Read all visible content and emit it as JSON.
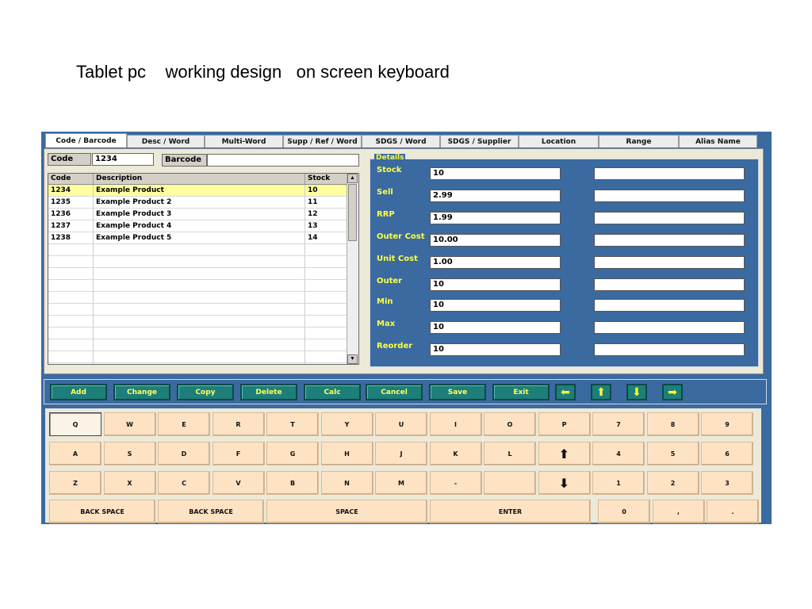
{
  "slide_title": "Tablet pc    working design   on screen keyboard",
  "tabs": [
    "Code / Barcode",
    "Desc / Word",
    "Multi-Word",
    "Supp / Ref / Word",
    "SDGS / Word",
    "SDGS / Supplier",
    "Location",
    "Range",
    "Alias Name"
  ],
  "search": {
    "code_label": "Code",
    "code_value": "1234",
    "barcode_label": "Barcode",
    "barcode_value": ""
  },
  "grid": {
    "headers": [
      "Code",
      "Description",
      "Stock"
    ],
    "rows": [
      {
        "code": "1234",
        "desc": "Example Product",
        "stock": "10",
        "selected": true
      },
      {
        "code": "1235",
        "desc": "Example Product 2",
        "stock": "11"
      },
      {
        "code": "1236",
        "desc": "Example Product 3",
        "stock": "12"
      },
      {
        "code": "1237",
        "desc": "Example Product 4",
        "stock": "13"
      },
      {
        "code": "1238",
        "desc": "Example Product 5",
        "stock": "14"
      }
    ]
  },
  "details": {
    "legend": "Details",
    "fields": [
      {
        "label": "Stock",
        "value": "10"
      },
      {
        "label": "Sell",
        "value": "2.99"
      },
      {
        "label": "RRP",
        "value": "1.99"
      },
      {
        "label": "Outer Cost",
        "value": "10.00"
      },
      {
        "label": "Unit Cost",
        "value": "1.00"
      },
      {
        "label": "Outer",
        "value": "10"
      },
      {
        "label": "Min",
        "value": "10"
      },
      {
        "label": "Max",
        "value": "10"
      },
      {
        "label": "Reorder",
        "value": "10"
      }
    ]
  },
  "actions": [
    "Add",
    "Change",
    "Copy",
    "Delete",
    "Calc",
    "Cancel",
    "Save",
    "Exit"
  ],
  "arrow_buttons": [
    {
      "name": "left-arrow",
      "glyph": "⬅"
    },
    {
      "name": "up-arrow",
      "glyph": "⬆"
    },
    {
      "name": "down-arrow",
      "glyph": "⬇"
    },
    {
      "name": "right-arrow",
      "glyph": "➡"
    }
  ],
  "keyboard": {
    "row1": [
      "Q",
      "W",
      "E",
      "R",
      "T",
      "Y",
      "U",
      "I",
      "O",
      "P",
      "7",
      "8",
      "9"
    ],
    "row2": [
      "A",
      "S",
      "D",
      "F",
      "G",
      "H",
      "J",
      "K",
      "L",
      "⬆",
      "4",
      "5",
      "6"
    ],
    "row3": [
      "Z",
      "X",
      "C",
      "V",
      "B",
      "N",
      "M",
      "-",
      "",
      "⬇",
      "1",
      "2",
      "3"
    ],
    "row4": [
      "BACK SPACE",
      "BACK SPACE",
      "SPACE",
      "ENTER",
      "0",
      ",",
      "."
    ]
  },
  "colors": {
    "app_background": "#3a6aa0",
    "label_yellow": "#ffff40",
    "button_teal": "#1e7e79",
    "key_peach": "#fde2c4",
    "selected_row": "#ffffa0"
  }
}
